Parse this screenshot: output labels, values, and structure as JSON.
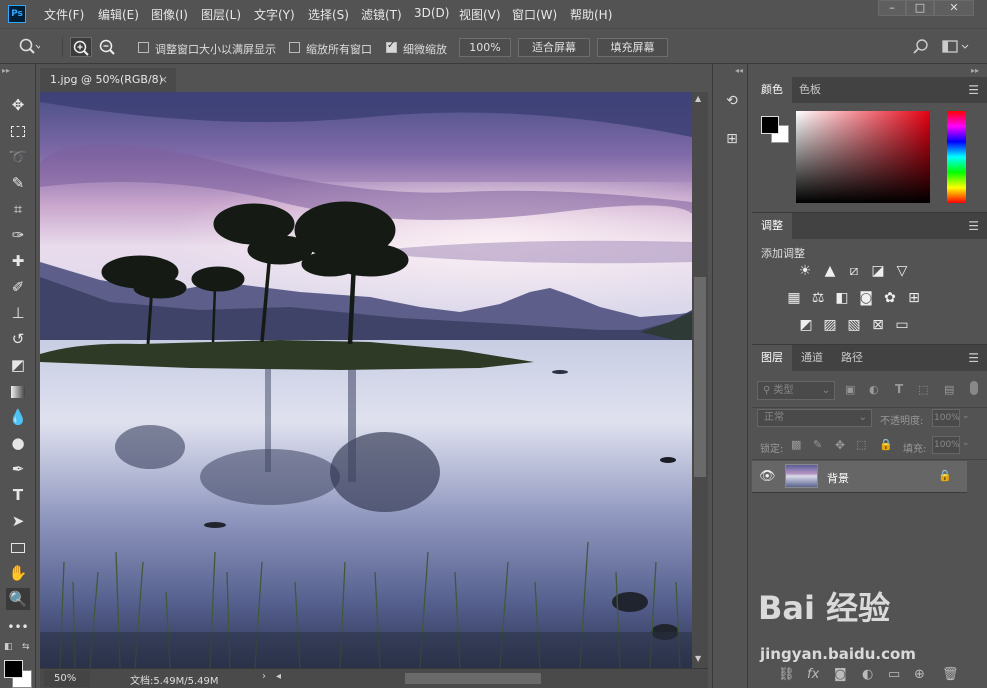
{
  "app": {
    "logo": "Ps"
  },
  "menu": [
    "文件(F)",
    "编辑(E)",
    "图像(I)",
    "图层(L)",
    "文字(Y)",
    "选择(S)",
    "滤镜(T)",
    "3D(D)",
    "视图(V)",
    "窗口(W)",
    "帮助(H)"
  ],
  "window_controls": {
    "minimize": "–",
    "maximize": "□",
    "close": "✕"
  },
  "options": {
    "resize_windows_label": "调整窗口大小以满屏显示",
    "resize_windows_checked": false,
    "zoom_all_label": "缩放所有窗口",
    "zoom_all_checked": false,
    "scrubby_label": "细微缩放",
    "scrubby_checked": true,
    "zoom_value": "100%",
    "fit_screen_label": "适合屏幕",
    "fill_screen_label": "填充屏幕"
  },
  "document": {
    "tab_title": "1.jpg @ 50%(RGB/8)",
    "close": "×",
    "zoom": "50%",
    "doc_size": "文档:5.49M/5.49M"
  },
  "panels": {
    "color": {
      "tabs": [
        "颜色",
        "色板"
      ]
    },
    "adjustments": {
      "title": "调整",
      "add_label": "添加调整"
    },
    "layers": {
      "tabs": [
        "图层",
        "通道",
        "路径"
      ],
      "filter_kind": "类型",
      "blend_mode": "正常",
      "opacity_label": "不透明度:",
      "opacity_value": "100%",
      "lock_label": "锁定:",
      "fill_label": "填充:",
      "fill_value": "100%",
      "layer_name": "背景"
    }
  },
  "watermark": {
    "brand": "Bai 经验",
    "url": "jingyan.baidu.com"
  },
  "colors": {
    "background": "#535353",
    "panel_dark": "#424242",
    "canvas_bg": "#282828",
    "accent": "#31a8ff"
  }
}
